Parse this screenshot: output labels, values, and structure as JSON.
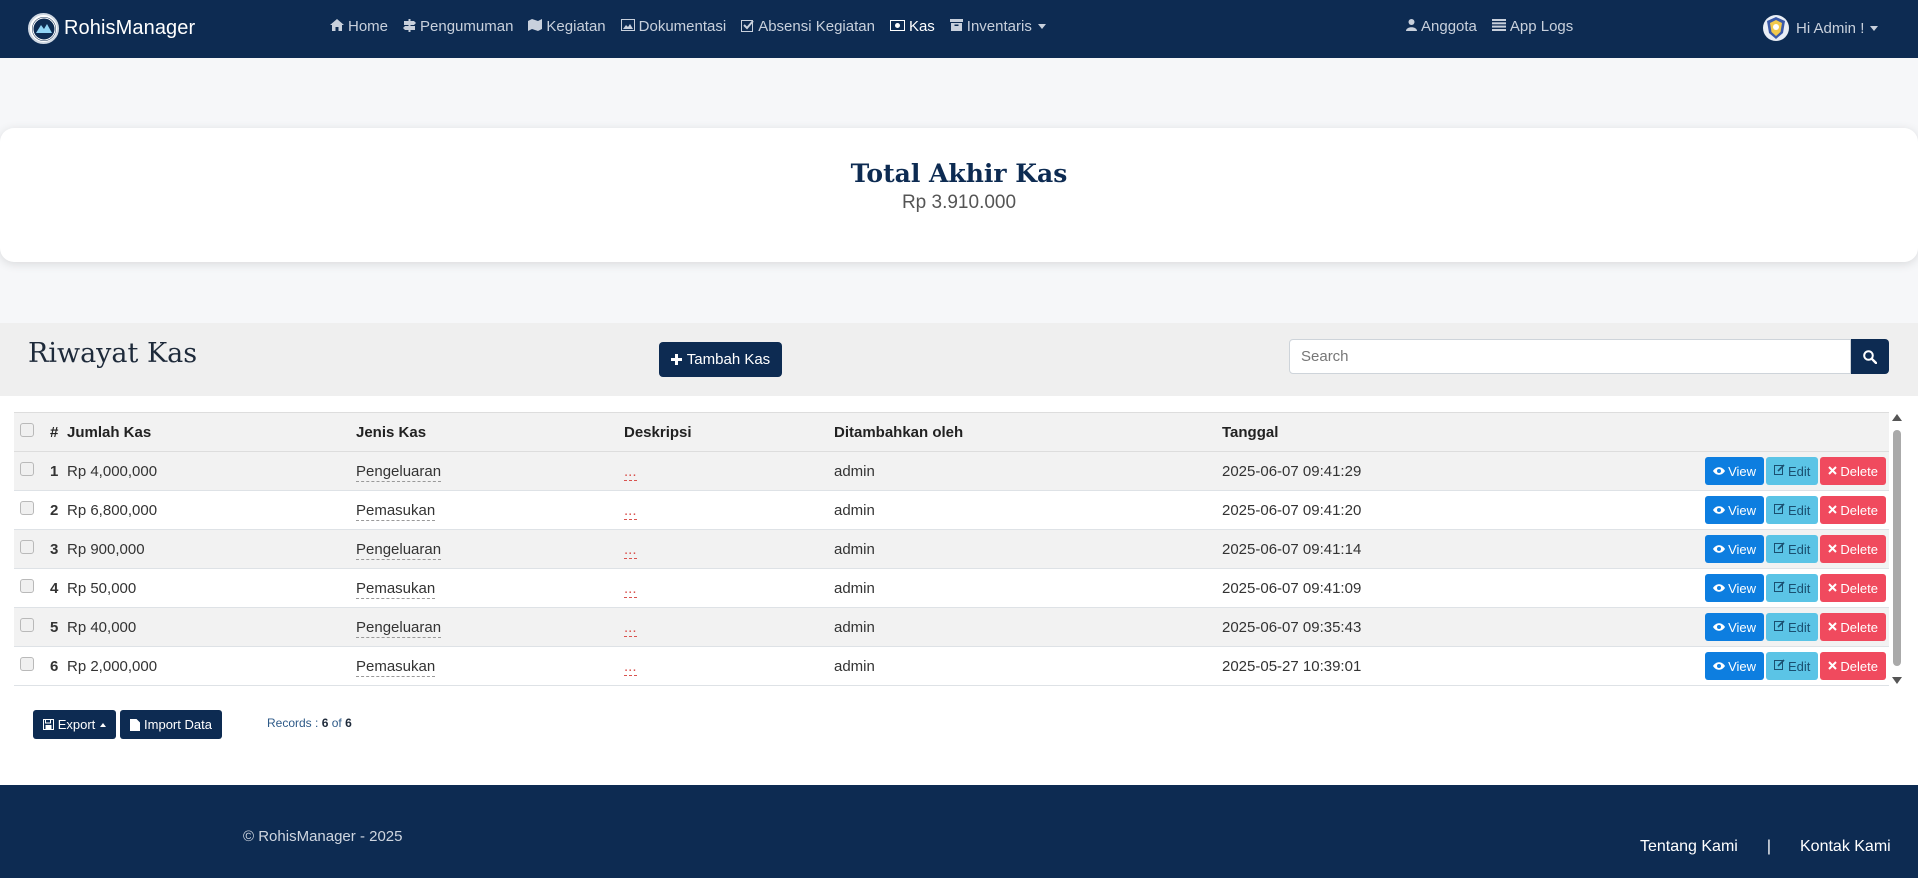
{
  "navbar": {
    "brand": "RohisManager",
    "links": [
      {
        "label": "Home",
        "icon": "home-icon"
      },
      {
        "label": "Pengumuman",
        "icon": "signpost-icon"
      },
      {
        "label": "Kegiatan",
        "icon": "map-icon"
      },
      {
        "label": "Dokumentasi",
        "icon": "image-icon"
      },
      {
        "label": "Absensi Kegiatan",
        "icon": "checkbox-icon"
      },
      {
        "label": "Kas",
        "icon": "money-icon"
      },
      {
        "label": "Inventaris",
        "icon": "archive-icon"
      }
    ],
    "right_links": [
      {
        "label": "Anggota",
        "icon": "user-icon"
      },
      {
        "label": "App Logs",
        "icon": "list-icon"
      }
    ],
    "user_greeting": "Hi Admin !"
  },
  "summary": {
    "title": "Total Akhir Kas",
    "value": "Rp 3.910.000"
  },
  "history": {
    "title": "Riwayat Kas",
    "add_button": "Tambah Kas",
    "search_placeholder": "Search"
  },
  "table": {
    "columns": [
      "#",
      "Jumlah Kas",
      "Jenis Kas",
      "Deskripsi",
      "Ditambahkan oleh",
      "Tanggal"
    ],
    "rows": [
      {
        "no": "1",
        "amount": "Rp 4,000,000",
        "type": "Pengeluaran",
        "desc": "...",
        "by": "admin",
        "date": "2025-06-07 09:41:29"
      },
      {
        "no": "2",
        "amount": "Rp 6,800,000",
        "type": "Pemasukan",
        "desc": "...",
        "by": "admin",
        "date": "2025-06-07 09:41:20"
      },
      {
        "no": "3",
        "amount": "Rp 900,000",
        "type": "Pengeluaran",
        "desc": "...",
        "by": "admin",
        "date": "2025-06-07 09:41:14"
      },
      {
        "no": "4",
        "amount": "Rp 50,000",
        "type": "Pemasukan",
        "desc": "...",
        "by": "admin",
        "date": "2025-06-07 09:41:09"
      },
      {
        "no": "5",
        "amount": "Rp 40,000",
        "type": "Pengeluaran",
        "desc": "...",
        "by": "admin",
        "date": "2025-06-07 09:35:43"
      },
      {
        "no": "6",
        "amount": "Rp 2,000,000",
        "type": "Pemasukan",
        "desc": "...",
        "by": "admin",
        "date": "2025-05-27 10:39:01"
      }
    ],
    "actions": {
      "view": "View",
      "edit": "Edit",
      "delete": "Delete"
    }
  },
  "table_footer": {
    "export_label": "Export",
    "import_label": "Import Data",
    "records_prefix": "Records : ",
    "records_shown": "6",
    "records_of": " of ",
    "records_total": "6"
  },
  "footer": {
    "copyright": "© RohisManager - 2025",
    "link_about": "Tentang Kami",
    "separator": "|",
    "link_contact": "Kontak Kami"
  },
  "colors": {
    "primary": "#0d2b52",
    "view": "#0d7ee0",
    "edit": "#5bc4e6",
    "delete": "#f04a5e"
  }
}
